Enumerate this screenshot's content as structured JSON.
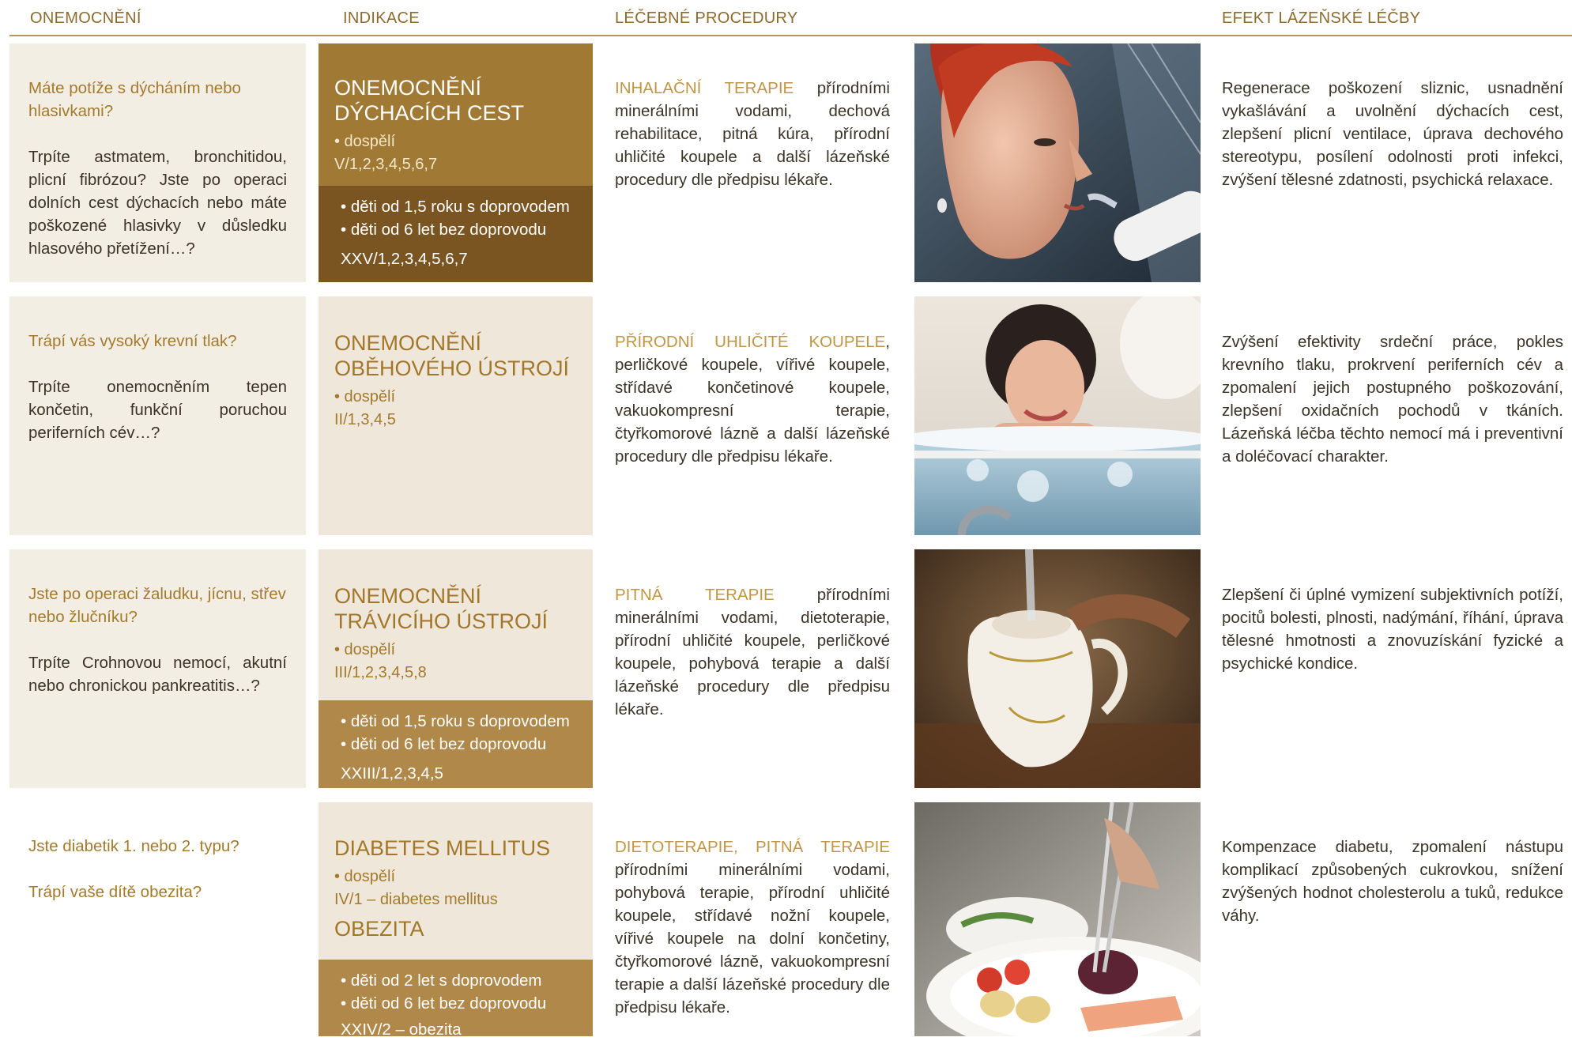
{
  "headers": {
    "disease": "ONEMOCNĚNÍ",
    "indication": "INDIKACE",
    "procedures": "LÉČEBNÉ PROCEDURY",
    "effect": "EFEKT LÁZEŇSKÉ LÉČBY"
  },
  "rows": [
    {
      "question": "Máte potíže s dýcháním nebo hlasivkami?",
      "text": "Trpíte astmatem, bronchitidou, plicní fibrózou? Jste po operaci dolních cest dýchacích nebo máte poškozené hlasivky v důsledku hlasového přetížení…?",
      "indication_title": "ONEMOCNĚNÍ DÝCHACÍCH CEST",
      "adult": "• dospělí",
      "adult_code": "V/1,2,3,4,5,6,7",
      "child1": "• děti od 1,5 roku s doprovodem",
      "child2": "• děti od 6 let bez doprovodu",
      "child_code": "XXV/1,2,3,4,5,6,7",
      "proc_highlight": "INHALAČNÍ TERAPIE",
      "proc_text": " přírodními minerálními vodami, dechová rehabilitace, pitná kúra, přírodní uhličité koupele a další lázeňské procedury dle předpisu lékaře.",
      "photo": "woman-inhalation-photo",
      "effect": "Regenerace poškození sliznic, usnadnění vykašlávání a uvolnění dýchacích cest, zlepšení plicní ventilace, úprava dechového stereotypu, posílení odolnosti proti infekci, zvýšení tělesné zdatnosti, psychická relaxace."
    },
    {
      "question": "Trápí vás vysoký krevní tlak?",
      "text": "Trpíte onemocněním tepen končetin, funkční poruchou periferních cév…?",
      "indication_title": "ONEMOCNĚNÍ OBĚHOVÉHO ÚSTROJÍ",
      "adult": "• dospělí",
      "adult_code": "II/1,3,4,5",
      "proc_highlight": "PŘÍRODNÍ UHLIČITÉ KOUPELE",
      "proc_text": ", perličkové koupele, vířivé koupele, střídavé končetinové koupele, vakuokompresní terapie, čtyřkomorové lázně a další lázeňské procedury dle předpisu lékaře.",
      "photo": "woman-bath-photo",
      "effect": "Zvýšení efektivity srdeční práce, pokles krevního tlaku, prokrvení periferních cév a zpomalení jejich postupného poškozování, zlepšení oxidačních pochodů v tkáních. Lázeňská léčba těchto nemocí má i preventivní a doléčovací charakter."
    },
    {
      "question": "Jste po operaci žaludku, jícnu, střev nebo žlučníku?",
      "text": "Trpíte Crohnovou nemocí, akutní nebo chronickou pankreatitis…?",
      "indication_title": "ONEMOCNĚNÍ TRÁVICÍHO ÚSTROJÍ",
      "adult": "• dospělí",
      "adult_code": "III/1,2,3,4,5,8",
      "child1": "• děti od 1,5 roku s doprovodem",
      "child2": "• děti od 6 let bez doprovodu",
      "child_code": "XXIII/1,2,3,4,5",
      "proc_highlight": "PITNÁ TERAPIE",
      "proc_text": " přírodními minerálními vodami, dietoterapie, přírodní uhličité koupele, perličkové koupele, pohybová terapie a další lázeňské procedury dle předpisu lékaře.",
      "photo": "spa-cup-photo",
      "effect": "Zlepšení či úplné vymizení subjektivních potíží, pocitů bolesti, plnosti, nadýmání, říhání, úprava tělesné hmotnosti a znovuzískání fyzické a psychické kondice."
    },
    {
      "question": "Jste diabetik 1. nebo 2. typu?",
      "question2": "Trápí vaše dítě obezita?",
      "indication_title": "DIABETES MELLITUS",
      "adult": "• dospělí",
      "adult_code": "IV/1 – diabetes mellitus",
      "indication_title2": "OBEZITA",
      "child1": "• děti od 2 let s doprovodem",
      "child2": "• děti od 6 let bez doprovodu",
      "child_code": "XXIV/2 – obezita",
      "proc_highlight": "DIETOTERAPIE, PITNÁ TERAPIE",
      "proc_text": " přírodními minerálními vodami, pohybová terapie, přírodní uhličité koupele, střídavé nožní koupele, vířivé koupele na dolní končetiny, čtyřkomorové lázně, vakuokompresní terapie a další lázeňské procedury dle předpisu lékaře.",
      "photo": "diet-plate-photo",
      "effect": "Kompenzace diabetu, zpomalení nástupu komplikací způsobených cukrovkou, snížení zvýšených hodnot cholesterolu a tuků, redukce váhy."
    }
  ]
}
